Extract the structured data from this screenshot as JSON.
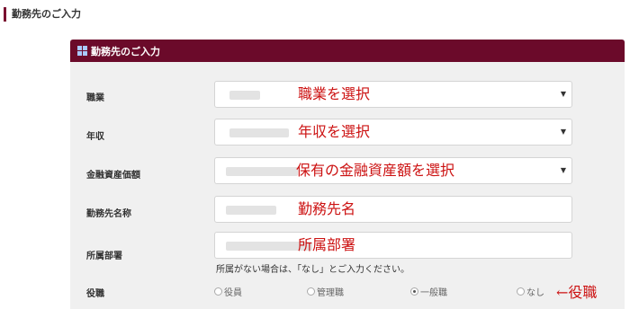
{
  "page": {
    "heading": "勤務先のご入力"
  },
  "panel": {
    "title": "勤務先のご入力"
  },
  "fields": [
    {
      "label": "職業",
      "annotation": "職業を選択",
      "type": "select"
    },
    {
      "label": "年収",
      "annotation": "年収を選択",
      "type": "select"
    },
    {
      "label": "金融資産価額",
      "annotation": "保有の金融資産額を選択",
      "type": "select"
    },
    {
      "label": "勤務先名称",
      "annotation": "勤務先名",
      "type": "text"
    },
    {
      "label": "所属部署",
      "annotation": "所属部署",
      "type": "text"
    }
  ],
  "hint": "所属がない場合は、「なし」とご入力ください。",
  "position": {
    "label": "役職",
    "options": [
      "役員",
      "管理職",
      "一般職",
      "なし"
    ],
    "selected": "一般職",
    "annotation": "←役職"
  },
  "colors": {
    "header": "#6b0a2a",
    "annotation": "#cc1111",
    "panel": "#f0f0f0"
  }
}
